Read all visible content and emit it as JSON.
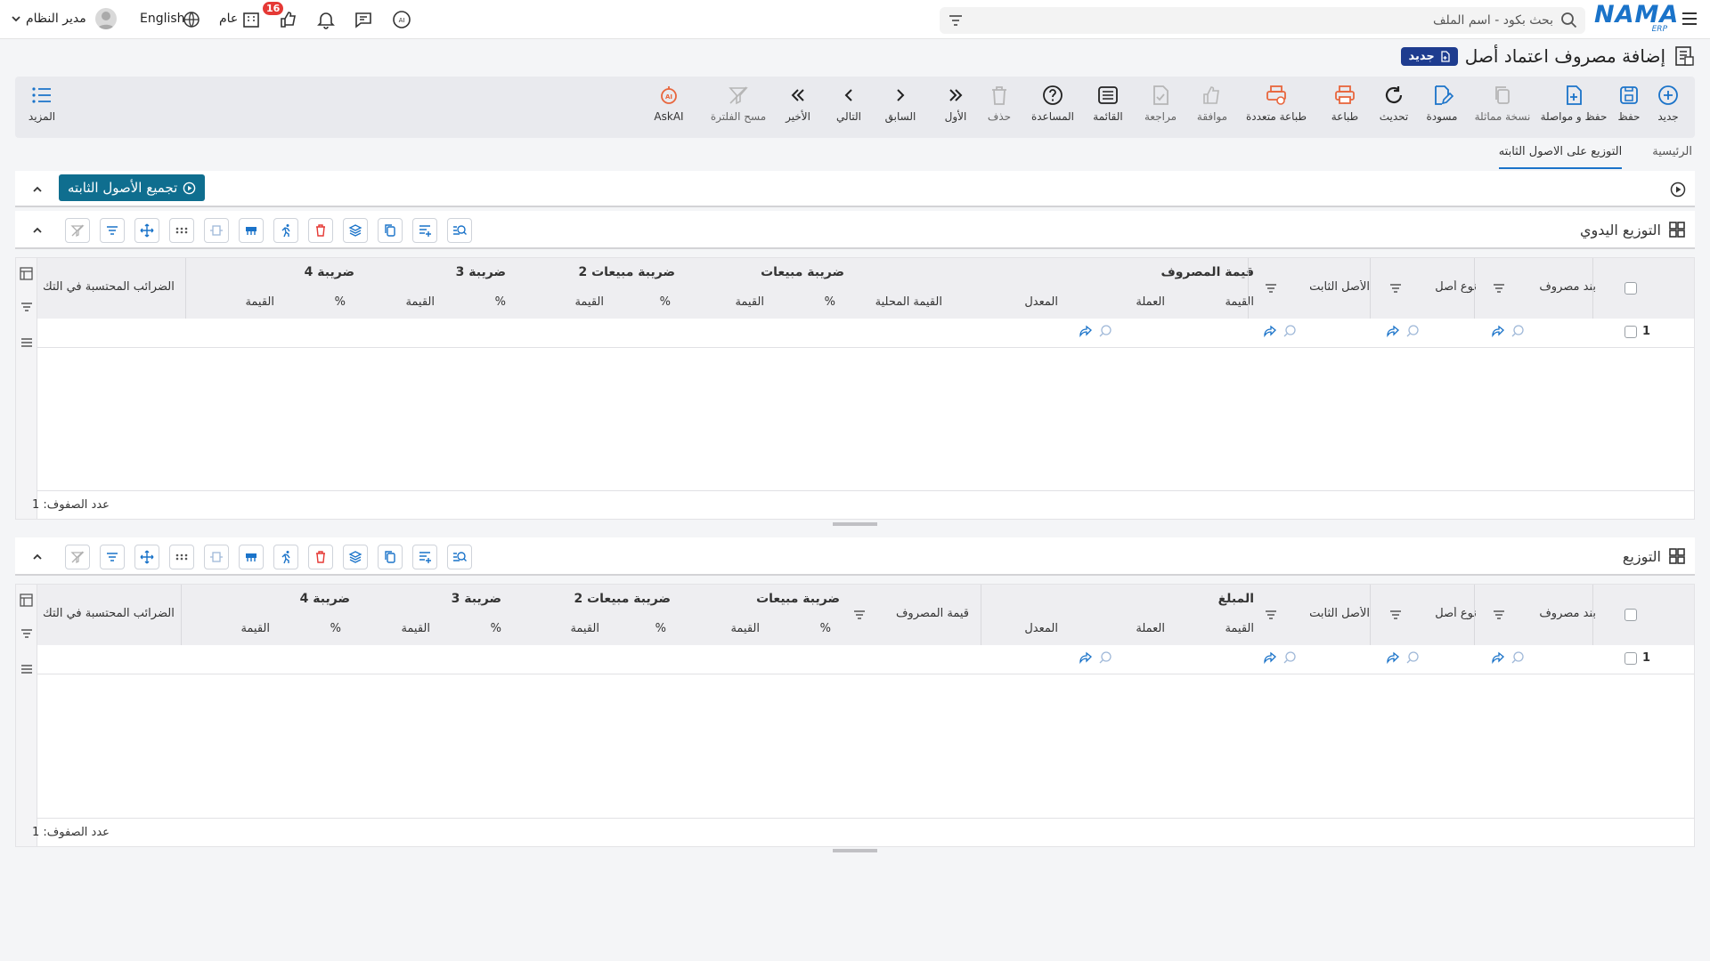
{
  "topbar": {
    "logo": "NAMA",
    "logo_sub": "ERP",
    "search_placeholder": "بحث بكود - اسم الملف",
    "notifications_badge": "16",
    "general_label": "عام",
    "language": "English",
    "user": "مدير النظام"
  },
  "page": {
    "title": "إضافة مصروف اعتماد أصل",
    "new_chip": "جديد"
  },
  "toolbar": {
    "new": "جديد",
    "save": "حفظ",
    "save_continue": "حفظ و مواصلة",
    "duplicate": "نسخة مماثلة",
    "draft": "مسودة",
    "refresh": "تحديث",
    "print": "طباعة",
    "multi_print": "طباعة متعددة",
    "approve": "موافقة",
    "review": "مراجعة",
    "list": "القائمة",
    "help": "المساعدة",
    "delete": "حذف",
    "first": "الأول",
    "previous": "السابق",
    "next": "التالي",
    "last": "الأخير",
    "clear_filter": "مسح الفلترة",
    "askai": "AskAI",
    "more": "المزيد"
  },
  "tabs": {
    "main": "الرئيسية",
    "distribution": "التوزيع على الاصول الثابته"
  },
  "collect_button": "تجميع الأصول الثابته",
  "grid1": {
    "title": "التوزيع اليدوي",
    "col_expense_item": "بند مصروف",
    "col_asset_type": "نوع أصل",
    "col_fixed_asset": "الأصل الثابت",
    "grp_expense_value": "قيمة المصروف",
    "grp_sales_tax": "ضريبة مبيعات",
    "grp_sales_tax2": "ضريبة مبيعات 2",
    "grp_tax3": "ضريبة 3",
    "grp_tax4": "ضريبة 4",
    "col_withheld_taxes": "الضرائب المحتسبة في التك",
    "sub_value": "القيمة",
    "sub_currency": "العملة",
    "sub_rate": "المعدل",
    "sub_local_value": "القيمة المحلية",
    "sub_percent": "%",
    "row_number": "1",
    "row_count": "عدد الصفوف: 1"
  },
  "grid2": {
    "title": "التوزيع",
    "col_expense_item": "بند مصروف",
    "col_asset_type": "نوع أصل",
    "col_fixed_asset": "الأصل الثابت",
    "grp_amount": "المبلغ",
    "col_expense_value": "قيمة المصروف",
    "grp_sales_tax": "ضريبة مبيعات",
    "grp_sales_tax2": "ضريبة مبيعات 2",
    "grp_tax3": "ضريبة 3",
    "grp_tax4": "ضريبة 4",
    "col_withheld_taxes": "الضرائب المحتسبة في التك",
    "sub_value": "القيمة",
    "sub_currency": "العملة",
    "sub_rate": "المعدل",
    "sub_percent": "%",
    "row_number": "1",
    "row_count": "عدد الصفوف: 1"
  },
  "colors": {
    "brand": "#1a73c9",
    "primary_button": "#0f6e8f",
    "chip": "#1e3c8f",
    "badge": "#e53935",
    "orange_icon": "#e8663d"
  }
}
